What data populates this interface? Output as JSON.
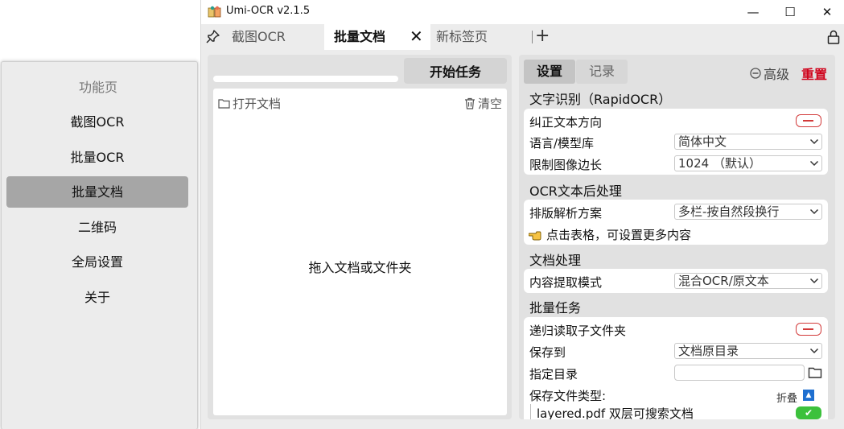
{
  "nav": {
    "title": "功能页",
    "items": [
      "截图OCR",
      "批量OCR",
      "批量文档",
      "二维码",
      "全局设置",
      "关于"
    ],
    "active_index": 2
  },
  "window": {
    "title": "Umi-OCR v2.1.5",
    "minimize": "—",
    "maximize": "☐",
    "close": "✕"
  },
  "tabs": {
    "items": [
      "截图OCR",
      "批量文档",
      "新标签页"
    ],
    "active_index": 1,
    "close_glyph": "✕",
    "add_glyph": "+"
  },
  "left": {
    "start_button": "开始任务",
    "open_doc": "打开文档",
    "clear": "清空",
    "drop_hint": "拖入文档或文件夹",
    "progress": 0
  },
  "settings": {
    "tab_settings": "设置",
    "tab_records": "记录",
    "advanced": "高级",
    "reset": "重置",
    "sections": {
      "ocr": "文字识别（RapidOCR）",
      "post": "OCR文本后处理",
      "doc": "文档处理",
      "batch": "批量任务"
    },
    "rows": {
      "correct_direction": "纠正文本方向",
      "language": "语言/模型库",
      "language_value": "简体中文",
      "limit_side": "限制图像边长",
      "limit_side_value": "1024 （默认）",
      "layout_scheme": "排版解析方案",
      "layout_scheme_value": "多栏-按自然段换行",
      "table_hint": "点击表格，可设置更多内容",
      "extract_mode": "内容提取模式",
      "extract_mode_value": "混合OCR/原文本",
      "recursive": "递归读取子文件夹",
      "save_to": "保存到",
      "save_to_value": "文档原目录",
      "target_dir": "指定目录",
      "target_dir_value": "",
      "save_types": "保存文件类型:",
      "fold": "折叠",
      "layered_pdf": "layered.pdf 双层可搜索文档"
    }
  },
  "colors": {
    "reset": "#d0021b",
    "switch_off": "#d23a3a",
    "check_on": "#3cc13c",
    "fold_toggle": "#1e6fd0",
    "nav_active": "#a6a6a6"
  }
}
